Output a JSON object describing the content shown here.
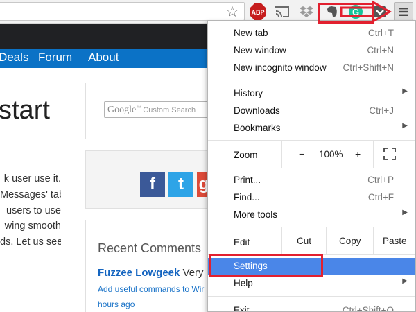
{
  "toolbar": {
    "icons": [
      "star-icon",
      "abp-icon",
      "cast-icon",
      "dropbox-icon",
      "evernote-icon",
      "grammarly-icon",
      "pocket-icon",
      "menu-icon"
    ],
    "abp_label": "ABP",
    "grammarly_label": "G"
  },
  "nav": {
    "items": [
      "Deals",
      "Forum",
      "About"
    ],
    "background": "#0b72c6"
  },
  "page": {
    "headline": "start",
    "body_lines": [
      "k user use it.",
      "Messages' tab",
      "users to use",
      "wing smooth",
      "ds. Let us see"
    ]
  },
  "sidebar": {
    "search_brand": "Google",
    "search_tm": "™",
    "search_placeholder": "Custom Search",
    "social": [
      "f",
      "t",
      "g"
    ],
    "recent_comments_title": "Recent Comments",
    "comment_author": "Fuzzee Lowgeek",
    "comment_author_tail": "Very",
    "comment_link": "Add useful commands to Wir",
    "comment_time": "hours ago"
  },
  "menu": {
    "new_tab": {
      "label": "New tab",
      "shortcut": "Ctrl+T"
    },
    "new_window": {
      "label": "New window",
      "shortcut": "Ctrl+N"
    },
    "new_incognito": {
      "label": "New incognito window",
      "shortcut": "Ctrl+Shift+N"
    },
    "history": {
      "label": "History"
    },
    "downloads": {
      "label": "Downloads",
      "shortcut": "Ctrl+J"
    },
    "bookmarks": {
      "label": "Bookmarks"
    },
    "zoom": {
      "label": "Zoom",
      "minus": "−",
      "value": "100%",
      "plus": "+"
    },
    "print": {
      "label": "Print...",
      "shortcut": "Ctrl+P"
    },
    "find": {
      "label": "Find...",
      "shortcut": "Ctrl+F"
    },
    "more_tools": {
      "label": "More tools"
    },
    "edit": {
      "label": "Edit",
      "cut": "Cut",
      "copy": "Copy",
      "paste": "Paste"
    },
    "settings": {
      "label": "Settings"
    },
    "help": {
      "label": "Help"
    },
    "exit": {
      "label": "Exit",
      "shortcut": "Ctrl+Shift+Q"
    },
    "highlight_color": "#4a86e8"
  },
  "annotation": {
    "color": "#e2202f"
  }
}
